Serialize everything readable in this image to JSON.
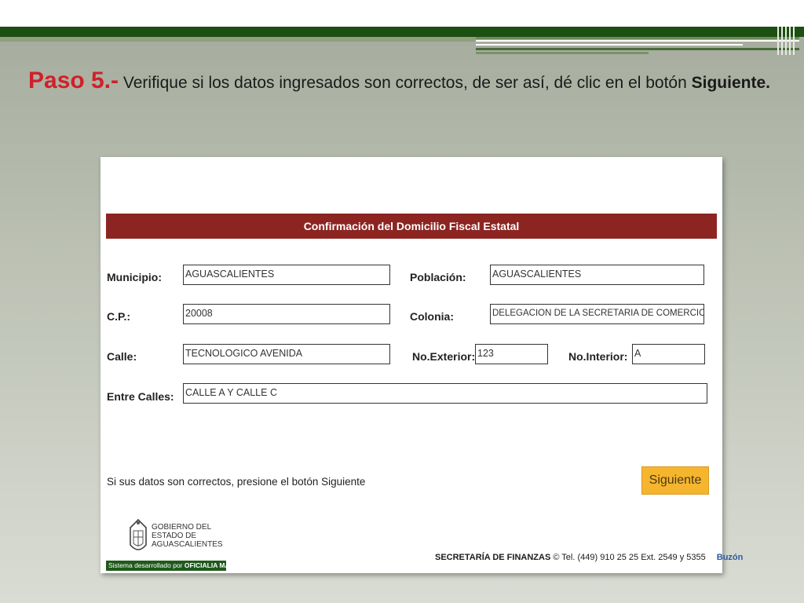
{
  "slide": {
    "step_label": "Paso 5.-",
    "instruction_text": " Verifique si los datos ingresados son correctos, de ser así, dé clic en el botón ",
    "instruction_bold": "Siguiente."
  },
  "form": {
    "title": "Confirmación del Domicilio Fiscal Estatal",
    "fields": {
      "municipio": {
        "label": "Municipio:",
        "value": "AGUASCALIENTES"
      },
      "poblacion": {
        "label": "Población:",
        "value": "AGUASCALIENTES"
      },
      "cp": {
        "label": "C.P.:",
        "value": "20008"
      },
      "colonia": {
        "label": "Colonia:",
        "value": "DELEGACION DE LA SECRETARIA DE COMERCIO Y FO/"
      },
      "calle": {
        "label": "Calle:",
        "value": "TECNOLOGICO AVENIDA"
      },
      "no_exterior": {
        "label": "No.Exterior:",
        "value": "123"
      },
      "no_interior": {
        "label": "No.Interior:",
        "value": "A"
      },
      "entre_calles": {
        "label": "Entre Calles:",
        "value": "CALLE A Y CALLE C"
      }
    },
    "notice": "Si sus datos son correctos, presione el botón Siguiente",
    "next_button": "Siguiente"
  },
  "footer": {
    "gov_line1": "GOBIERNO DEL",
    "gov_line2": "ESTADO DE",
    "gov_line3": "AGUASCALIENTES",
    "developed_by": "Sistema desarrollado por ",
    "developed_org": "OFICIALIA MAYOR",
    "secretaria": "SECRETARÍA DE FINANZAS",
    "contact": " © Tel. (449) 910 25 25  Ext. 2549 y 5355",
    "buzon": "Buzón"
  },
  "colors": {
    "header_red": "#8c2521",
    "button_orange": "#f6b52f",
    "title_red": "#d0202a",
    "rule_green": "#1c4f12"
  }
}
